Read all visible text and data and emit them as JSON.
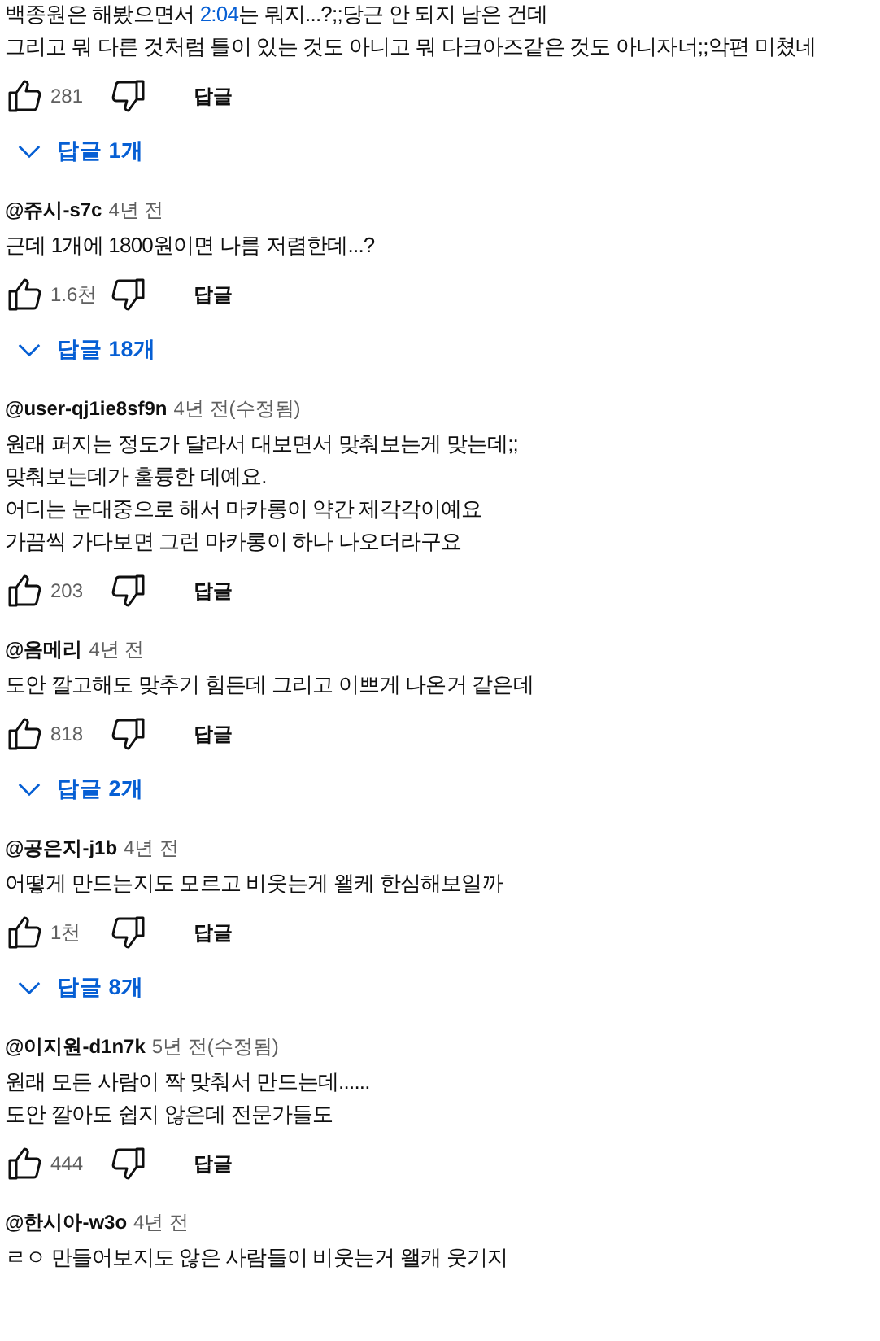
{
  "comments": [
    {
      "body": [
        {
          "segments": [
            {
              "kind": "text",
              "text": "백종원은 해봤으면서 "
            },
            {
              "kind": "link",
              "text": "2:04"
            },
            {
              "kind": "text",
              "text": "는 뭐지...?;;당근 안 되지 남은 건데"
            }
          ]
        },
        "그리고 뭐 다른 것처럼 틀이 있는 것도 아니고 뭐 다크아즈같은 것도  아니자너;;악편 미쳤네"
      ],
      "likes": "281",
      "reply_button": "답글",
      "replies": "답글 1개"
    },
    {
      "author": "@쥬시-s7c",
      "time": "4년 전",
      "body": [
        "근데 1개에 1800원이면 나름 저렴한데...?"
      ],
      "likes": "1.6천",
      "reply_button": "답글",
      "replies": "답글 18개"
    },
    {
      "author": "@user-qj1ie8sf9n",
      "time": "4년 전(수정됨)",
      "body": [
        "원래 퍼지는 정도가 달라서 대보면서 맞춰보는게 맞는데;;",
        "맞춰보는데가 훌륭한 데예요.",
        "어디는 눈대중으로 해서 마카롱이 약간 제각각이예요",
        "가끔씩 가다보면 그런 마카롱이 하나 나오더라구요"
      ],
      "likes": "203",
      "reply_button": "답글"
    },
    {
      "author": "@음메리",
      "time": "4년 전",
      "body": [
        "도안 깔고해도 맞추기 힘든데 그리고 이쁘게 나온거 같은데"
      ],
      "likes": "818",
      "reply_button": "답글",
      "replies": "답글 2개"
    },
    {
      "author": "@공은지-j1b",
      "time": "4년 전",
      "body": [
        "어떻게 만드는지도 모르고 비웃는게 왤케 한심해보일까"
      ],
      "likes": "1천",
      "reply_button": "답글",
      "replies": "답글 8개"
    },
    {
      "author": "@이지원-d1n7k",
      "time": "5년 전(수정됨)",
      "body": [
        "원래 모든 사람이 짝 맞춰서 만드는데......",
        "도안 깔아도 쉽지 않은데 전문가들도"
      ],
      "likes": "444",
      "reply_button": "답글"
    },
    {
      "author": "@한시아-w3o",
      "time": "4년 전",
      "body": [
        "ㄹㅇ 만들어보지도 않은 사람들이 비웃는거 왤캐 웃기지"
      ]
    }
  ]
}
